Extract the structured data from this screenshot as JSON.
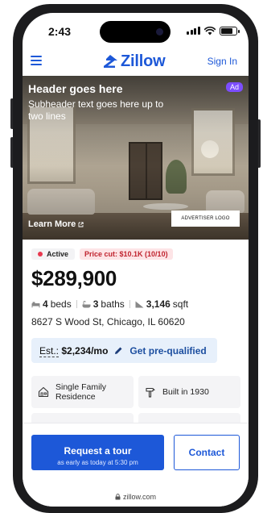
{
  "status_bar": {
    "time": "2:43",
    "battery_level": 0.8
  },
  "nav": {
    "logo_text": "Zillow",
    "signin_label": "Sign In"
  },
  "ad": {
    "header": "Header goes here",
    "subheader": "Subheader text goes here up to two lines",
    "badge": "Ad",
    "learn_more": "Learn More",
    "advertiser_logo": "ADVERTISER LOGO"
  },
  "listing": {
    "status": "Active",
    "price_cut": "Price cut: $10.1K (10/10)",
    "price": "$289,900",
    "beds_value": "4",
    "beds_label": "beds",
    "baths_value": "3",
    "baths_label": "baths",
    "sqft_value": "3,146",
    "sqft_label": "sqft",
    "address": "8627 S Wood St, Chicago, IL 60620",
    "estimate_label": "Est.:",
    "estimate_value": "$2,234/mo",
    "prequal_link": "Get pre-qualified"
  },
  "facts_cards": [
    {
      "text": "Single Family Residence",
      "icon": "house-icon"
    },
    {
      "text": "Built in 1930",
      "icon": "hammer-icon"
    }
  ],
  "actions": {
    "tour_label": "Request a tour",
    "tour_sub": "as early as today at 5:30 pm",
    "contact_label": "Contact"
  },
  "browser": {
    "url": "zillow.com"
  },
  "colors": {
    "brand_blue": "#1d58d8",
    "active_dot": "#e8384f",
    "ad_badge": "#7c4dff"
  }
}
